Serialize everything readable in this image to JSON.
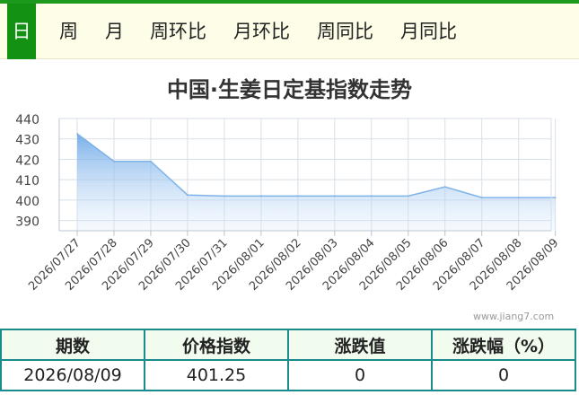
{
  "tabs": [
    {
      "label": "日",
      "active": true
    },
    {
      "label": "周",
      "active": false
    },
    {
      "label": "月",
      "active": false
    },
    {
      "label": "周环比",
      "active": false
    },
    {
      "label": "月环比",
      "active": false
    },
    {
      "label": "周同比",
      "active": false
    },
    {
      "label": "月同比",
      "active": false
    }
  ],
  "watermark": "www.jiang7.com",
  "table": {
    "headers": [
      "期数",
      "价格指数",
      "涨跌值",
      "涨跌幅（%）"
    ],
    "row": [
      "2026/08/09",
      "401.25",
      "0",
      "0"
    ]
  },
  "colors": {
    "accent": "#129112",
    "table_border": "#1b8a8a",
    "line": "#7fb3e8"
  },
  "chart_data": {
    "type": "area",
    "title": "中国·生姜日定基指数走势",
    "categories": [
      "2026/07/27",
      "2026/07/28",
      "2026/07/29",
      "2026/07/30",
      "2026/07/31",
      "2026/08/01",
      "2026/08/02",
      "2026/08/03",
      "2026/08/04",
      "2026/08/05",
      "2026/08/06",
      "2026/08/07",
      "2026/08/08",
      "2026/08/09"
    ],
    "values": [
      432.5,
      419,
      419,
      402.5,
      402,
      402,
      402,
      402,
      402,
      402,
      406.5,
      401.25,
      401.25,
      401.25
    ],
    "yticks": [
      390,
      400,
      410,
      420,
      430,
      440
    ],
    "ylim": [
      385,
      440
    ],
    "grid": true
  }
}
